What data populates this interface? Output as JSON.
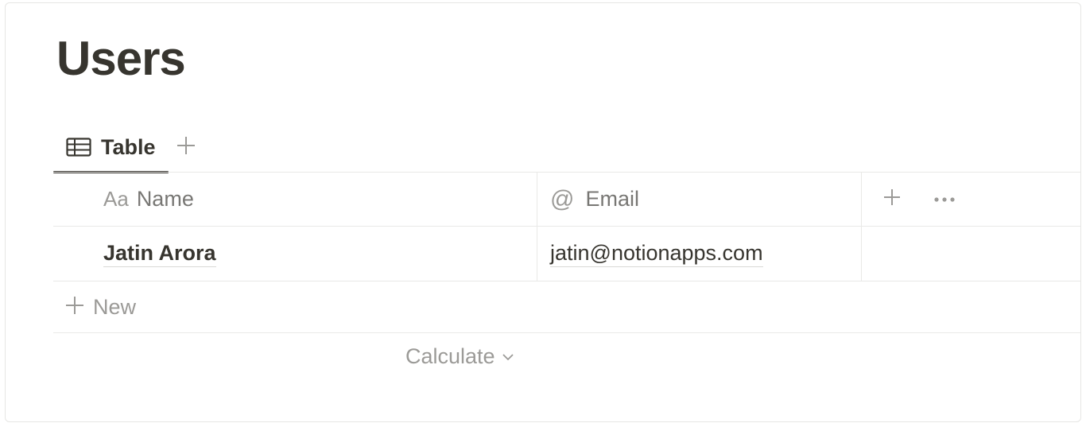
{
  "page": {
    "title": "Users"
  },
  "views": {
    "tabs": [
      {
        "label": "Table",
        "icon": "table-icon",
        "active": true
      }
    ],
    "add_icon": "plus-icon"
  },
  "table": {
    "columns": [
      {
        "label": "Name",
        "icon_text": "Aa",
        "icon": "text-property-icon"
      },
      {
        "label": "Email",
        "icon_text": "@",
        "icon": "email-property-icon"
      }
    ],
    "header_actions": [
      "plus-icon",
      "more-horizontal-icon"
    ],
    "rows": [
      {
        "name": "Jatin Arora",
        "email": "jatin@notionapps.com"
      }
    ],
    "new_label": "New",
    "calculate_label": "Calculate"
  },
  "colors": {
    "text": "#37352f",
    "muted": "#9b9a97",
    "border": "#e9e9e7"
  }
}
